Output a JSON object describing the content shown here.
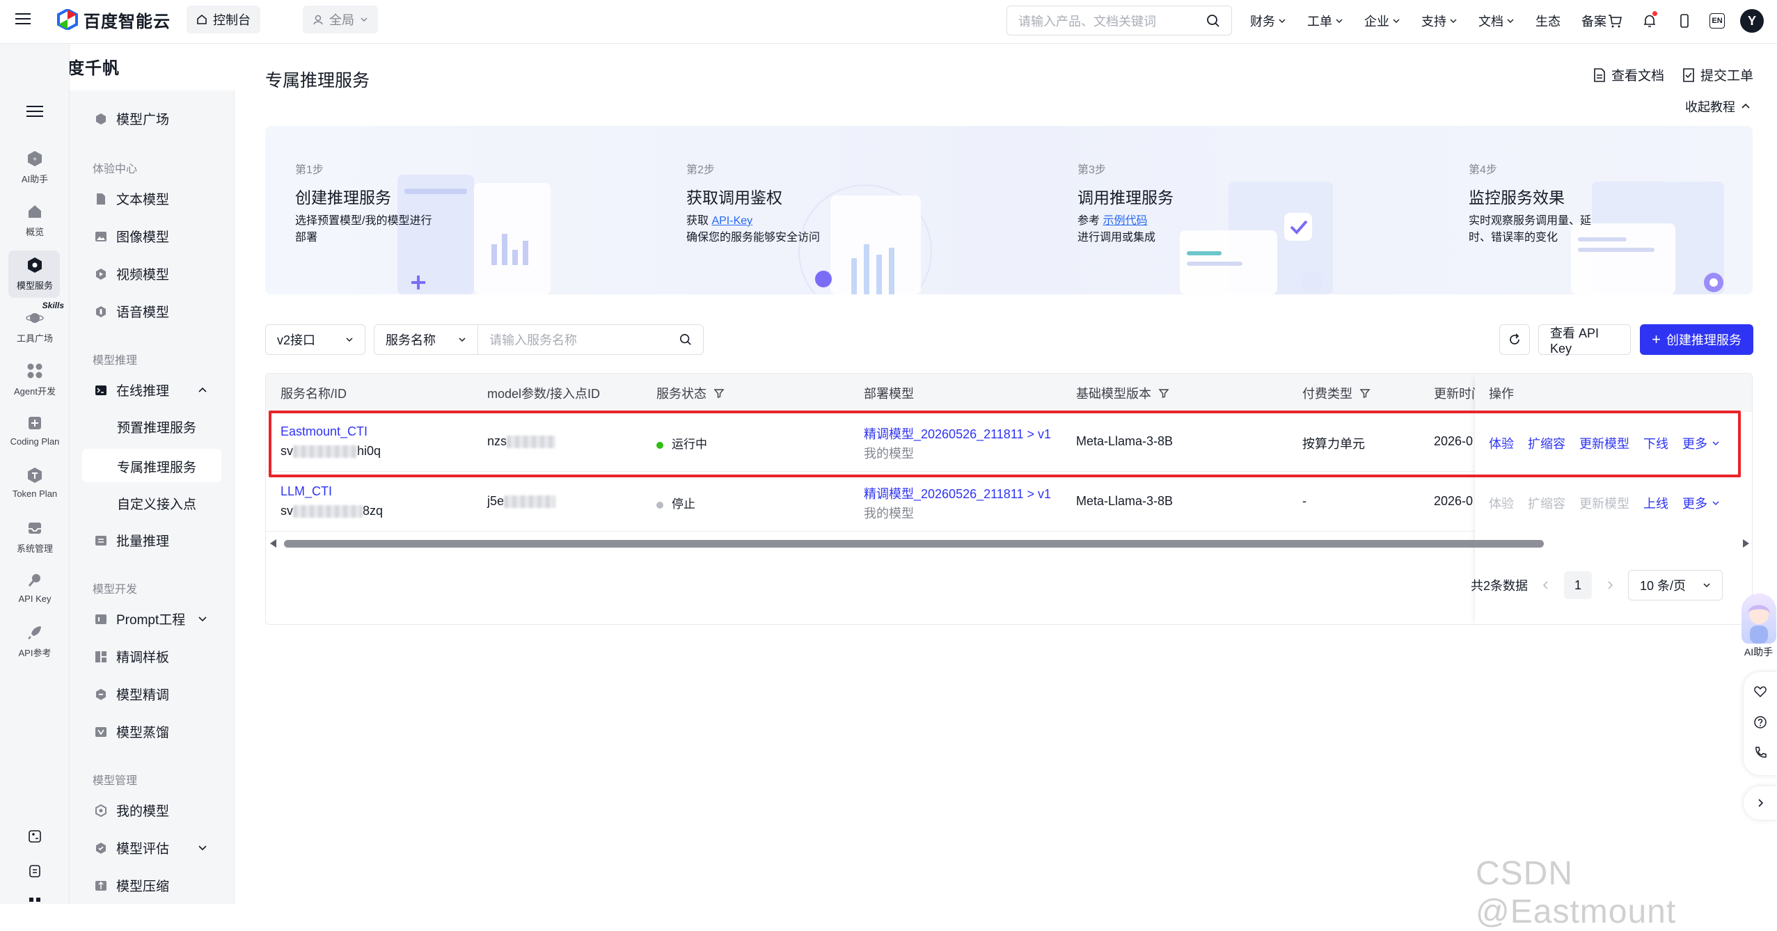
{
  "topbar": {
    "logo_text": "百度智能云",
    "console_label": "控制台",
    "region_label": "全局",
    "search_placeholder": "请输入产品、文档关键词",
    "nav": [
      {
        "label": "财务"
      },
      {
        "label": "工单"
      },
      {
        "label": "企业"
      },
      {
        "label": "支持"
      },
      {
        "label": "文档"
      },
      {
        "label": "生态"
      },
      {
        "label": "备案"
      }
    ],
    "lang_label": "EN",
    "avatar_letter": "Y"
  },
  "brand": {
    "name": "百度千帆"
  },
  "rail": {
    "items": [
      {
        "label": "AI助手",
        "icon": "ai-assistant-icon"
      },
      {
        "label": "概览",
        "icon": "home-icon"
      },
      {
        "label": "模型服务",
        "icon": "model-service-icon"
      },
      {
        "label": "工具广场",
        "icon": "planet-icon",
        "badge": "Skills"
      },
      {
        "label": "Agent开发",
        "icon": "grid-icon"
      },
      {
        "label": "Coding Plan",
        "icon": "code-plan-icon"
      },
      {
        "label": "Token Plan",
        "icon": "token-icon"
      },
      {
        "label": "系统管理",
        "icon": "inbox-icon"
      },
      {
        "label": "API Key",
        "icon": "key-icon"
      },
      {
        "label": "API参考",
        "icon": "rocket-icon"
      }
    ]
  },
  "side": {
    "model_square": "模型广场",
    "group_experience": "体验中心",
    "text_model": "文本模型",
    "image_model": "图像模型",
    "video_model": "视频模型",
    "voice_model": "语音模型",
    "group_inference": "模型推理",
    "online_inference": "在线推理",
    "preset_service": "预置推理服务",
    "dedicated_service": "专属推理服务",
    "custom_endpoint": "自定义接入点",
    "batch_inference": "批量推理",
    "group_dev": "模型开发",
    "prompt_eng": "Prompt工程",
    "tuning_samples": "精调样板",
    "model_tuning": "模型精调",
    "model_distill": "模型蒸馏",
    "group_manage": "模型管理",
    "my_models": "我的模型",
    "model_eval": "模型评估",
    "model_compress": "模型压缩"
  },
  "page": {
    "title": "专属推理服务",
    "view_docs": "查看文档",
    "submit_ticket": "提交工单",
    "collapse_tutorial": "收起教程"
  },
  "steps": [
    {
      "no": "第1步",
      "title": "创建推理服务",
      "desc_a": "选择预置模型/我的模型进行部署",
      "link": "",
      "desc_b": ""
    },
    {
      "no": "第2步",
      "title": "获取调用鉴权",
      "desc_a": "获取 ",
      "link": "API-Key",
      "desc_b": "确保您的服务能够安全访问"
    },
    {
      "no": "第3步",
      "title": "调用推理服务",
      "desc_a": "参考 ",
      "link": "示例代码",
      "desc_b": "进行调用或集成"
    },
    {
      "no": "第4步",
      "title": "监控服务效果",
      "desc_a": "实时观察服务调用量、延时、错误率的变化",
      "link": "",
      "desc_b": ""
    }
  ],
  "toolbar": {
    "api_version": "v2接口",
    "filter_field": "服务名称",
    "search_placeholder": "请输入服务名称",
    "view_api_key": "查看 API Key",
    "create_service": "创建推理服务"
  },
  "table": {
    "headers": {
      "name": "服务名称/ID",
      "model_params": "model参数/接入点ID",
      "status": "服务状态",
      "deployed_model": "部署模型",
      "base_version": "基础模型版本",
      "billing": "付费类型",
      "updated": "更新时间",
      "actions": "操作"
    },
    "rows": [
      {
        "name": "Eastmount_CTI",
        "id_prefix": "sv",
        "id_suffix": "hi0q",
        "model_param_prefix": "nzs",
        "model_param_suffix": "",
        "status": "运行中",
        "status_color": "#30bf13",
        "deployed_model": "精调模型_20260526_211811 > v1",
        "deployed_sub": "我的模型",
        "base_version": "Meta-Llama-3-8B",
        "billing": "按算力单元",
        "updated": "2026-0",
        "actions": {
          "try": "体验",
          "scale": "扩缩容",
          "update": "更新模型",
          "toggle": "下线",
          "more": "更多"
        },
        "actions_disabled": false
      },
      {
        "name": "LLM_CTI",
        "id_prefix": "sv",
        "id_suffix": "8zq",
        "model_param_prefix": "j5e",
        "model_param_suffix": "",
        "status": "停止",
        "status_color": "#b8bcc4",
        "deployed_model": "精调模型_20260526_211811 > v1",
        "deployed_sub": "我的模型",
        "base_version": "Meta-Llama-3-8B",
        "billing": "-",
        "updated": "2026-0",
        "actions": {
          "try": "体验",
          "scale": "扩缩容",
          "update": "更新模型",
          "toggle": "上线",
          "more": "更多"
        },
        "actions_disabled": true
      }
    ]
  },
  "pagination": {
    "total": "共2条数据",
    "current": "1",
    "page_size": "10 条/页"
  },
  "float": {
    "ai_label": "AI助手"
  },
  "watermark": "CSDN @Eastmount",
  "colors": {
    "primary": "#2e34f2",
    "highlight": "#e8242a",
    "running": "#30bf13"
  }
}
